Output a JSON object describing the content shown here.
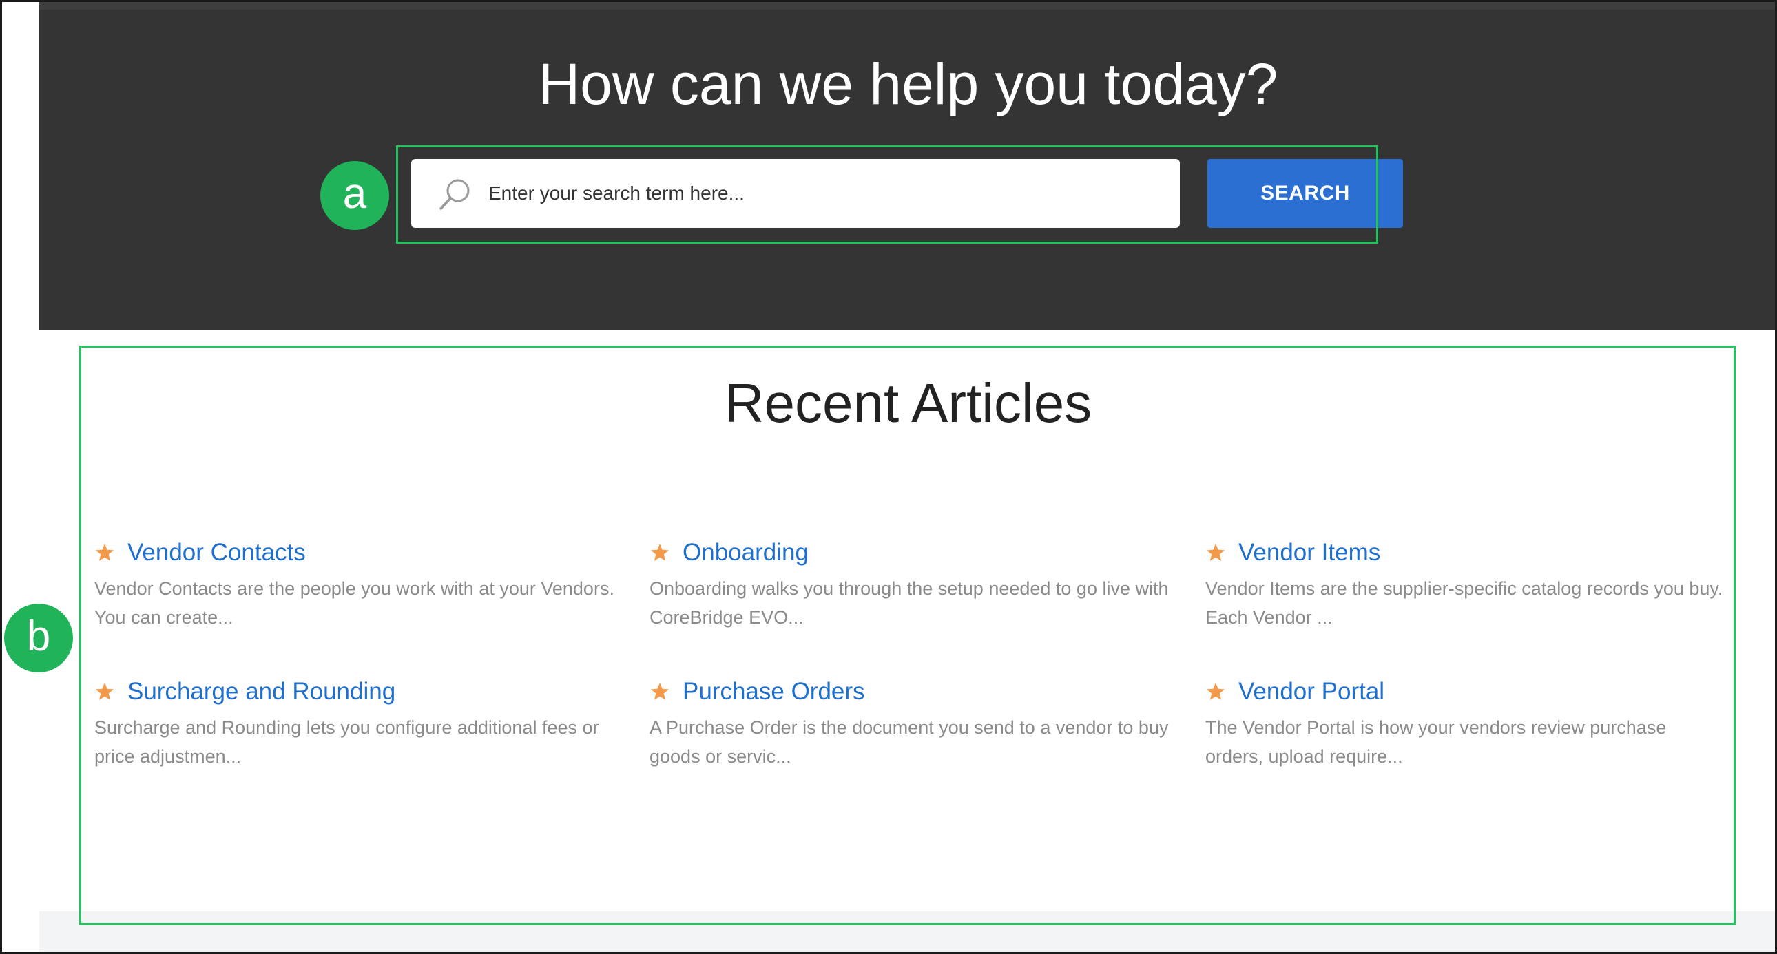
{
  "hero": {
    "title": "How can we help you today?",
    "search_placeholder": "Enter your search term here...",
    "search_button_label": "SEARCH"
  },
  "callouts": {
    "a": "a",
    "b": "b"
  },
  "recent": {
    "title": "Recent Articles",
    "articles": [
      {
        "title": "Vendor Contacts",
        "excerpt": "Vendor Contacts are the people you work with at your Vendors. You can create..."
      },
      {
        "title": "Onboarding",
        "excerpt": "Onboarding walks you through the setup needed to go live with CoreBridge EVO..."
      },
      {
        "title": "Vendor Items",
        "excerpt": "Vendor Items are the supplier-specific catalog records you buy. Each Vendor ..."
      },
      {
        "title": "Surcharge and Rounding",
        "excerpt": "Surcharge and Rounding lets you configure additional fees or price adjustmen..."
      },
      {
        "title": "Purchase Orders",
        "excerpt": "A Purchase Order is the document you send to a vendor to buy goods or servic..."
      },
      {
        "title": "Vendor Portal",
        "excerpt": "The Vendor Portal is how your vendors review purchase orders, upload require..."
      }
    ]
  },
  "colors": {
    "hero_bg": "#343434",
    "accent_button": "#2a6fd1",
    "link": "#1f6fcf",
    "star": "#f39a4a",
    "callout": "#23c45e"
  },
  "icons": {
    "search": "search-icon",
    "star": "star-icon"
  }
}
